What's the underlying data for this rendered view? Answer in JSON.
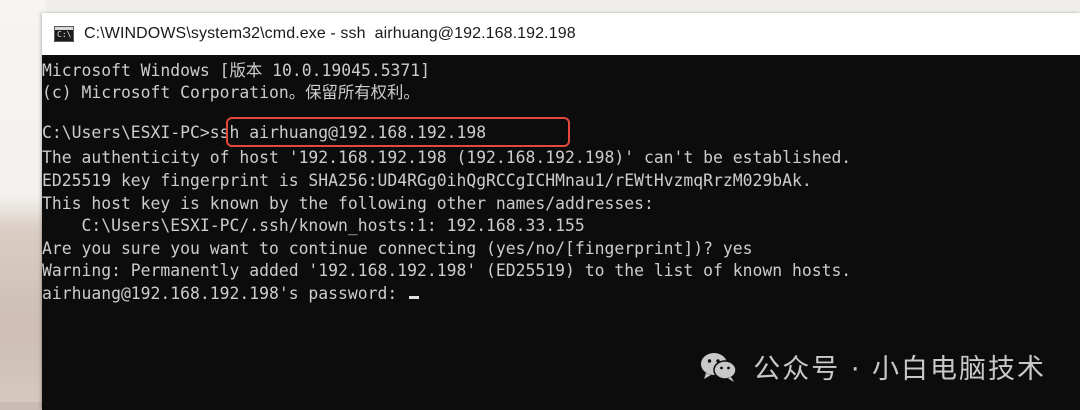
{
  "window": {
    "title": "C:\\WINDOWS\\system32\\cmd.exe - ssh  airhuang@192.168.192.198",
    "icon": "cmd-icon",
    "icon_glyph": "C:\\"
  },
  "console": {
    "lines": [
      "Microsoft Windows [版本 10.0.19045.5371]",
      "(c) Microsoft Corporation。保留所有权利。",
      "",
      "C:\\Users\\ESXI-PC>ssh airhuang@192.168.192.198",
      "The authenticity of host '192.168.192.198 (192.168.192.198)' can't be established.",
      "ED25519 key fingerprint is SHA256:UD4RGg0ihQgRCCgICHMnau1/rEWtHvzmqRrzM029bAk.",
      "This host key is known by the following other names/addresses:",
      "    C:\\Users\\ESXI-PC/.ssh/known_hosts:1: 192.168.33.155",
      "Are you sure you want to continue connecting (yes/no/[fingerprint])? yes",
      "Warning: Permanently added '192.168.192.198' (ED25519) to the list of known hosts.",
      "airhuang@192.168.192.198's password: "
    ],
    "highlight_color": "#e2493a"
  },
  "watermark": {
    "icon": "wechat-icon",
    "text": "公众号 · 小白电脑技术"
  }
}
